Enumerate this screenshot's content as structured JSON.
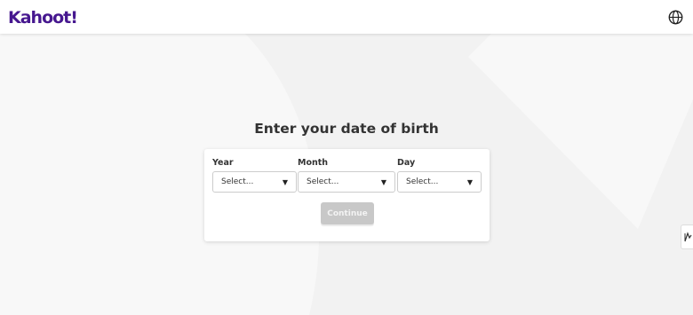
{
  "header": {
    "logo_text": "Kahoot!",
    "logo_color": "#46178f",
    "language_icon": "globe-icon"
  },
  "main": {
    "heading": "Enter your date of birth",
    "fields": [
      {
        "label": "Year",
        "value": "Select..."
      },
      {
        "label": "Month",
        "value": "Select..."
      },
      {
        "label": "Day",
        "value": "Select..."
      }
    ],
    "dropdown_icon": "triangle-down-icon",
    "continue_label": "Continue",
    "continue_disabled": true
  },
  "side_widget": {
    "icon": "chart-icon"
  },
  "colors": {
    "background": "#f2f2f2",
    "card": "#ffffff",
    "button_disabled": "#c8c8c8"
  }
}
